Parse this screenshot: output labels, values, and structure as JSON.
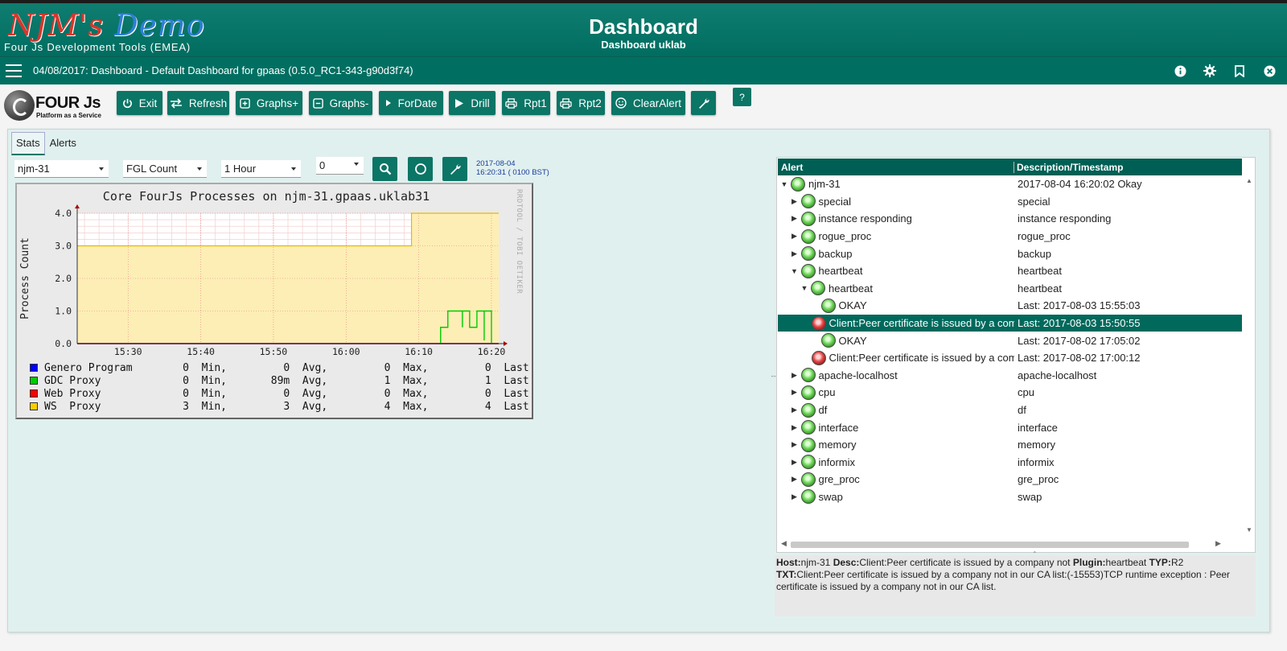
{
  "header": {
    "logo_part1": "NJM's",
    "logo_part2": "Demo",
    "logo_sub": "Four Js Development Tools (EMEA)",
    "title": "Dashboard",
    "subtitle": "Dashboard uklab"
  },
  "navbar": {
    "text": "04/08/2017: Dashboard - Default Dashboard for gpaas (0.5.0_RC1-343-g90d3f74)",
    "icons": [
      "info-icon",
      "gear-icon",
      "bookmark-icon",
      "close-icon"
    ]
  },
  "toolbar": {
    "logo_text": "FOUR Js",
    "logo_small": "Platform as a Service",
    "buttons": [
      {
        "label": "Exit",
        "icon": "power-icon"
      },
      {
        "label": "Refresh",
        "icon": "swap-arrows-icon"
      },
      {
        "label": "Graphs+",
        "icon": "plus-square-icon"
      },
      {
        "label": "Graphs-",
        "icon": "minus-square-icon"
      },
      {
        "label": "ForDate",
        "icon": "play-small-icon"
      },
      {
        "label": "Drill",
        "icon": "play-icon"
      },
      {
        "label": "Rpt1",
        "icon": "printer-icon"
      },
      {
        "label": "Rpt2",
        "icon": "printer-icon"
      },
      {
        "label": "ClearAlert",
        "icon": "smiley-icon"
      },
      {
        "label": "",
        "icon": "wrench-icon"
      }
    ],
    "help_label": "?"
  },
  "tabs": [
    {
      "label": "Stats",
      "active": true
    },
    {
      "label": "Alerts",
      "active": false
    }
  ],
  "filters": {
    "host": "njm-31",
    "metric": "FGL Count",
    "period": "1 Hour",
    "offset": "0",
    "date_line1": "2017-08-04",
    "date_line2": "16:20:31 ( 0100 BST)"
  },
  "chart_data": {
    "type": "area",
    "title": "Core FourJs Processes on njm-31.gpaas.uklab31",
    "credit": "RRDTOOL / TOBI OETIKER",
    "ylabel": "Process Count",
    "xlabel": "",
    "ylim": [
      0,
      4
    ],
    "yticks": [
      "0.0",
      "1.0",
      "2.0",
      "3.0",
      "4.0"
    ],
    "xlim": [
      "15:23",
      "16:21"
    ],
    "xticks": [
      "15:30",
      "15:40",
      "15:50",
      "16:00",
      "16:10",
      "16:20"
    ],
    "grid": true,
    "series": [
      {
        "name": "Genero Program",
        "color": "#0000ff",
        "x": [
          "15:23",
          "16:21"
        ],
        "values": [
          0,
          0
        ]
      },
      {
        "name": "GDC Proxy",
        "color": "#00cc00",
        "x": [
          "16:13",
          "16:13",
          "16:14",
          "16:14",
          "16:16",
          "16:16",
          "16:16",
          "16:16",
          "16:17",
          "16:17",
          "16:18",
          "16:18",
          "16:19",
          "16:19",
          "16:19",
          "16:19",
          "16:20",
          "16:20"
        ],
        "values": [
          0,
          0.5,
          0.5,
          1,
          1,
          0.5,
          0.5,
          1,
          1,
          0.5,
          0.5,
          1,
          1,
          0.1,
          0.1,
          1,
          1,
          0
        ]
      },
      {
        "name": "Web Proxy",
        "color": "#ff0000",
        "x": [
          "15:23",
          "16:21"
        ],
        "values": [
          0,
          0
        ]
      },
      {
        "name": "WS  Proxy",
        "color": "#ffcc00",
        "x": [
          "15:23",
          "16:09",
          "16:09",
          "16:21"
        ],
        "values": [
          3,
          3,
          4,
          4
        ]
      }
    ],
    "legend": [
      {
        "name": "Genero Program",
        "color": "#0000ff",
        "min": "0",
        "avg": "0",
        "max": "0",
        "last": "0"
      },
      {
        "name": "GDC Proxy",
        "color": "#00cc00",
        "min": "0",
        "avg": "89m",
        "max": "1",
        "last": "1"
      },
      {
        "name": "Web Proxy",
        "color": "#ff0000",
        "min": "0",
        "avg": "0",
        "max": "0",
        "last": "0"
      },
      {
        "name": "WS  Proxy",
        "color": "#ffcc00",
        "min": "3",
        "avg": "3",
        "max": "4",
        "last": "4"
      }
    ]
  },
  "tree": {
    "headers": {
      "alert": "Alert",
      "desc": "Description/Timestamp"
    },
    "rows": [
      {
        "level": 0,
        "twisty": "▼",
        "status": "green",
        "name": "njm-31",
        "desc": "2017-08-04 16:20:02 Okay"
      },
      {
        "level": 1,
        "twisty": "▶",
        "status": "green",
        "name": "special",
        "desc": "special"
      },
      {
        "level": 1,
        "twisty": "▶",
        "status": "green",
        "name": "instance responding",
        "desc": "instance responding"
      },
      {
        "level": 1,
        "twisty": "▶",
        "status": "green",
        "name": "rogue_proc",
        "desc": "rogue_proc"
      },
      {
        "level": 1,
        "twisty": "▶",
        "status": "green",
        "name": "backup",
        "desc": "backup"
      },
      {
        "level": 1,
        "twisty": "▼",
        "status": "green",
        "name": "heartbeat",
        "desc": "heartbeat"
      },
      {
        "level": 2,
        "twisty": "▼",
        "status": "green",
        "name": "heartbeat",
        "desc": "heartbeat"
      },
      {
        "level": 3,
        "twisty": "",
        "status": "green",
        "name": "OKAY",
        "desc": "Last: 2017-08-03 15:55:03"
      },
      {
        "level": 3,
        "twisty": "",
        "status": "red",
        "name": "Client:Peer certificate is issued by a company not in our CA list",
        "desc": "Last: 2017-08-03 15:50:55",
        "selected": true
      },
      {
        "level": 3,
        "twisty": "",
        "status": "green",
        "name": "OKAY",
        "desc": "Last: 2017-08-02 17:05:02"
      },
      {
        "level": 3,
        "twisty": "",
        "status": "red",
        "name": "Client:Peer certificate is issued by a company not in our CA list",
        "desc": "Last: 2017-08-02 17:00:12"
      },
      {
        "level": 1,
        "twisty": "▶",
        "status": "green",
        "name": "apache-localhost",
        "desc": "apache-localhost"
      },
      {
        "level": 1,
        "twisty": "▶",
        "status": "green",
        "name": "cpu",
        "desc": "cpu"
      },
      {
        "level": 1,
        "twisty": "▶",
        "status": "green",
        "name": "df",
        "desc": "df"
      },
      {
        "level": 1,
        "twisty": "▶",
        "status": "green",
        "name": "interface",
        "desc": "interface"
      },
      {
        "level": 1,
        "twisty": "▶",
        "status": "green",
        "name": "memory",
        "desc": "memory"
      },
      {
        "level": 1,
        "twisty": "▶",
        "status": "green",
        "name": "informix",
        "desc": "informix"
      },
      {
        "level": 1,
        "twisty": "▶",
        "status": "green",
        "name": "gre_proc",
        "desc": "gre_proc"
      },
      {
        "level": 1,
        "twisty": "▶",
        "status": "green",
        "name": "swap",
        "desc": "swap"
      }
    ]
  },
  "detail": {
    "host_label": "Host:",
    "host": "njm-31",
    "desc_label": "Desc:",
    "desc": "Client:Peer certificate is issued by a company not",
    "plugin_label": "Plugin:",
    "plugin": "heartbeat",
    "typ_label": "TYP:",
    "typ": "R2",
    "txt_label": "TXT:",
    "txt": "Client:Peer certificate is issued by a company not in our CA list:(-15553)TCP runtime exception : Peer certificate is issued by a company not in our CA list."
  }
}
